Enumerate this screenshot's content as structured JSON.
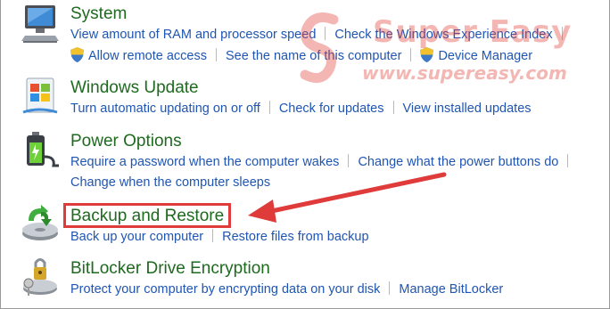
{
  "sections": [
    {
      "title": "System",
      "icon": "system-computer-icon",
      "link_rows": [
        [
          {
            "label": "View amount of RAM and processor speed",
            "shield": false
          },
          {
            "label": "Check the Windows Experience Index",
            "shield": false
          }
        ],
        [
          {
            "label": "Allow remote access",
            "shield": true
          },
          {
            "label": "See the name of this computer",
            "shield": false
          },
          {
            "label": "Device Manager",
            "shield": true
          }
        ]
      ]
    },
    {
      "title": "Windows Update",
      "icon": "windows-update-icon",
      "link_rows": [
        [
          {
            "label": "Turn automatic updating on or off",
            "shield": false
          },
          {
            "label": "Check for updates",
            "shield": false
          },
          {
            "label": "View installed updates",
            "shield": false
          }
        ]
      ]
    },
    {
      "title": "Power Options",
      "icon": "power-options-battery-icon",
      "link_rows": [
        [
          {
            "label": "Require a password when the computer wakes",
            "shield": false
          },
          {
            "label": "Change what the power buttons do",
            "shield": false
          }
        ],
        [
          {
            "label": "Change when the computer sleeps",
            "shield": false
          }
        ]
      ]
    },
    {
      "title": "Backup and Restore",
      "icon": "backup-restore-icon",
      "link_rows": [
        [
          {
            "label": "Back up your computer",
            "shield": false
          },
          {
            "label": "Restore files from backup",
            "shield": false
          }
        ]
      ]
    },
    {
      "title": "BitLocker Drive Encryption",
      "icon": "bitlocker-keys-icon",
      "link_rows": [
        [
          {
            "label": "Protect your computer by encrypting data on your disk",
            "shield": false
          },
          {
            "label": "Manage BitLocker",
            "shield": false
          }
        ]
      ]
    }
  ],
  "watermark": {
    "brand": "Super Easy",
    "url": "www.supereasy.com"
  },
  "colors": {
    "title_green": "#1e6a1e",
    "link_blue": "#1f55b3",
    "highlight_red": "#e03b3b"
  }
}
